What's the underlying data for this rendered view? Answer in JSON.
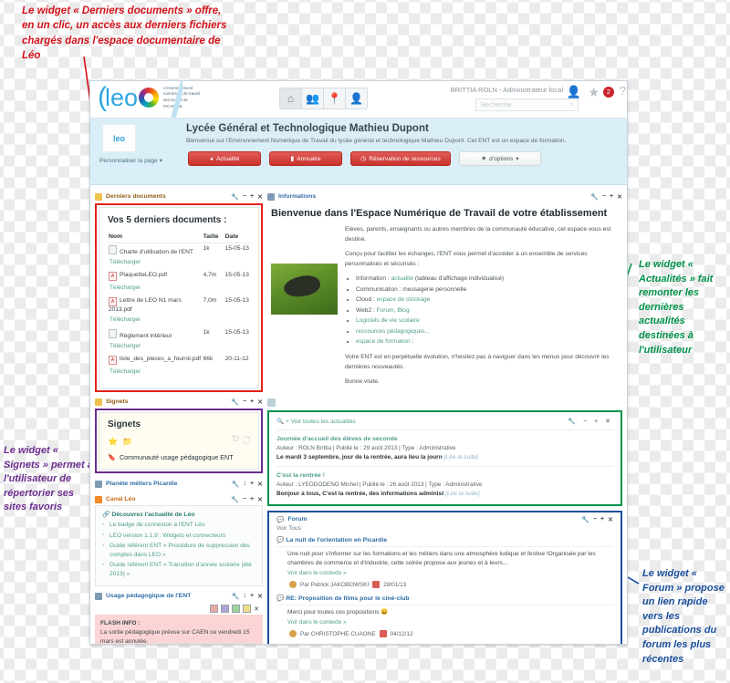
{
  "annotations": {
    "documents": "Le widget « Derniers documents » offre, en un clic, un accès aux derniers fichiers chargés dans l'espace documentaire de Léo",
    "actualites": "Le widget « Actualités » fait remonter les dernières actualités destinées à l'utilisateur",
    "signets": "Le widget « Signets » permet à l'utilisateur de répertorier ses sites favoris",
    "forum": "Le widget « Forum » propose un lien rapide vers les publications du forum les plus récentes",
    "colors": {
      "documents": "#d3121a",
      "actualites": "#00924b",
      "signets": "#6b2d8f",
      "forum": "#1a4f9c"
    }
  },
  "topbar": {
    "logo_text": "leo",
    "logo_tagline": "L'environnement numérique de travail des lycées de PICARDIE",
    "nav_icons": [
      "home-icon",
      "groups-icon",
      "pin-icon",
      "person-icon"
    ],
    "user_label": "BRITTIA ROLN - Administrateur local",
    "search_placeholder": "Recherche",
    "notification_count": "2"
  },
  "banner": {
    "title": "Lycée Général et Technologique Mathieu Dupont",
    "subtitle": "Bienvenue sur l'Environnement Numérique de Travail du lycée général et technologique Mathieu Dupont. Cet ENT est un espace de formation.",
    "personalize": "Personnaliser la page",
    "buttons": [
      {
        "label": "Actualité",
        "icon": "clock-icon"
      },
      {
        "label": "Annuaire",
        "icon": "book-icon"
      },
      {
        "label": "Réservation de ressources",
        "icon": "clock-icon"
      },
      {
        "label": "d'options",
        "icon": "gear-icon"
      }
    ]
  },
  "widgets": {
    "documents": {
      "title": "Derniers documents",
      "heading": "Vos 5 derniers documents :",
      "columns": [
        "Nom",
        "Taille",
        "Date"
      ],
      "download_label": "Télécharger",
      "rows": [
        {
          "name": "Charte d'utilisation de l'ENT",
          "size": "1k",
          "date": "15-05-13",
          "type": "doc"
        },
        {
          "name": "PlaquetteLEO.pdf",
          "size": "4,7m",
          "date": "15-05-13",
          "type": "pdf"
        },
        {
          "name": "Lettre de LEO N1 mars 2013.pdf",
          "size": "7,0m",
          "date": "15-05-13",
          "type": "pdf"
        },
        {
          "name": "Règlement intérieur",
          "size": "1k",
          "date": "15-05-13",
          "type": "doc"
        },
        {
          "name": "liste_des_pieces_a_fournir.pdf",
          "size": "66k",
          "date": "20-11-12",
          "type": "pdf"
        }
      ]
    },
    "signets": {
      "title": "Signets",
      "heading": "Signets",
      "item": "Communauté usage pédagogique ENT"
    },
    "planete": {
      "title": "Planète métiers Picardie"
    },
    "canal": {
      "title": "Canal Léo",
      "heading": "Découvrez l'actualité de Léo",
      "items": [
        "Le badge de connexion à l'ENT Léo",
        "LEO version 1.1.9 : Widgets et connecteurs",
        "Guide référent ENT « Procédure de suppression des comptes dans LEO »",
        "Guide référent ENT « Transition d'année scolaire (été 2013) »"
      ]
    },
    "usage": {
      "title": "Usage pédagogique de l'ENT",
      "swatches": [
        "#e8a9a9",
        "#b0a4d6",
        "#9ed39e",
        "#eee08a"
      ],
      "flash_title": "FLASH INFO :",
      "flash_text": "La sortie pédagogique prévue sur CAEN ce vendredi 15 mars est annulée."
    },
    "informations": {
      "title": "Informations",
      "heading": "Bienvenue dans l'Espace Numérique de Travail de votre établissement",
      "p1": "Elèves, parents, enseignants ou autres membres de la communauté éducative, cet espace vous est destiné.",
      "p2": "Conçu pour faciliter les échanges, l'ENT vous permet d'accéder à un ensemble de services personnalisés et sécurisés :",
      "bullets": [
        {
          "pre": "Information : ",
          "link": "actualité",
          "post": " (tableau d'affichage individualisé)"
        },
        {
          "pre": "Communication : messagerie personnelle",
          "link": "",
          "post": ""
        },
        {
          "pre": "Cloud : ",
          "link": "espace de stockage",
          "post": ""
        },
        {
          "pre": "Web2 : ",
          "link": "Forum, Blog",
          "post": ""
        },
        {
          "pre": "",
          "link": "Logiciels de vie scolaire",
          "post": ""
        },
        {
          "pre": "",
          "link": "ressources pédagogiques...",
          "post": ""
        },
        {
          "pre": "",
          "link": "espace de formation",
          "post": " :"
        }
      ],
      "p3": "Votre ENT est en perpétuelle évolution, n'hésitez pas à naviguer dans les menus pour découvrir les dernières nouveautés.",
      "p4": "Bonne visite."
    },
    "actualites": {
      "see_all": "+ Voir toutes les actualités",
      "news": [
        {
          "title": "Journée d'accueil des élèves de seconde",
          "meta": "Auteur : ROLN Brittia |  Publié le : 29 août 2013  | Type : Administrative",
          "excerpt": "Le mardi 3 septembre, jour de la rentrée, aura lieu la journ",
          "more": "[Lire la suite]"
        },
        {
          "title": "C'est la rentrée !",
          "meta": "Auteur : LYEODODENO Michel |  Publié le : 26 août 2013  | Type : Administrative",
          "excerpt": "Bonjour à tous, C'est la rentrée, des informations administ",
          "more": "[Lire la suite]"
        }
      ]
    },
    "forum": {
      "title": "Forum",
      "see_all": "Voir Tous",
      "context_label": "Voir dans le contexte »",
      "threads": [
        {
          "title": "La nuit de l'orientation en Picardie",
          "body": "Une nuit pour s'informer sur les formations et les métiers dans une atmosphère ludique et festive !Organisée par les chambres de commerce et d'industrie, cette soirée propose aux jeunes et à leurs...",
          "author": "Par Patrick JAKOBOWSKI",
          "date": "28/01/13"
        },
        {
          "title": "RE: Proposition de films pour le ciné-club",
          "body": "Merci pour toutes ces propositions 😄",
          "author": "Par CHRISTOPHE CUAONE",
          "date": "04/12/12"
        }
      ]
    }
  }
}
